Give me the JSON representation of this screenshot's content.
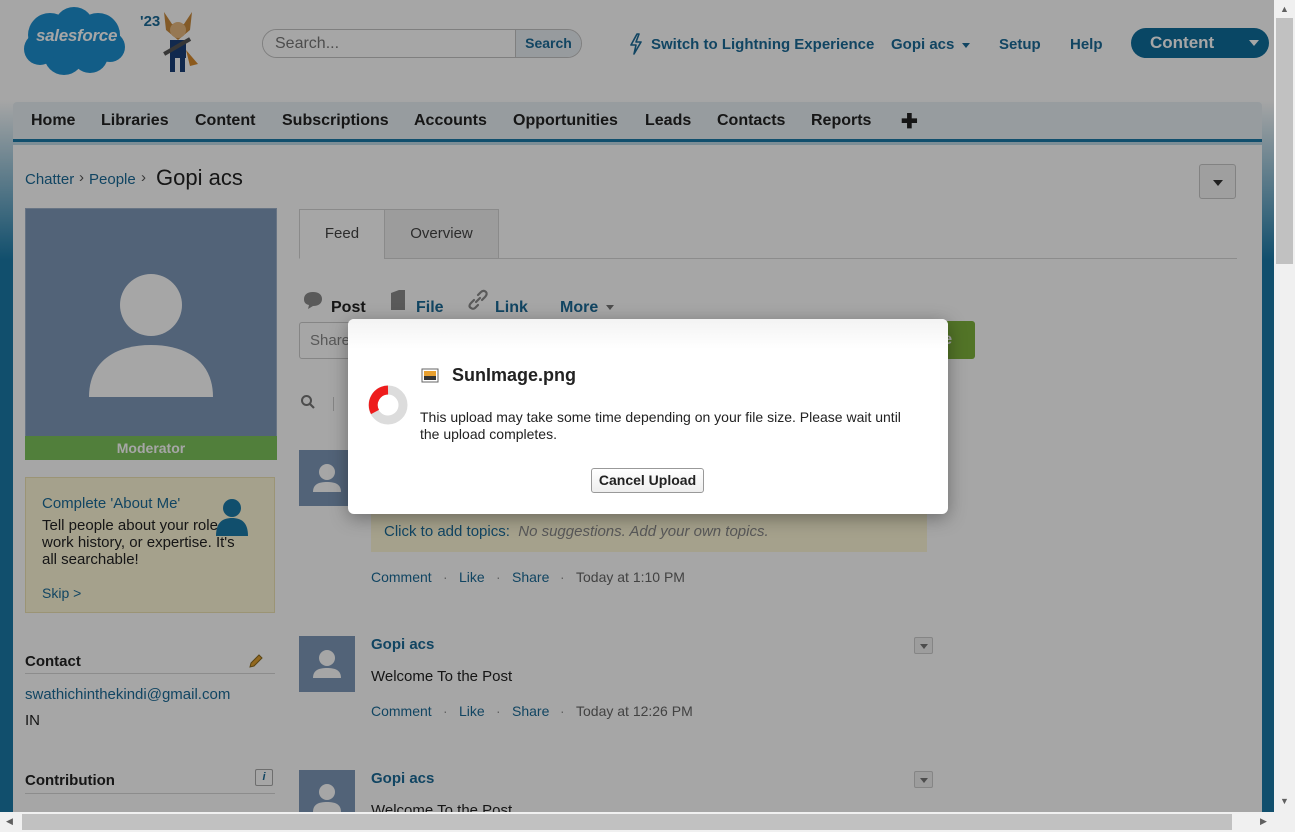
{
  "header": {
    "logo_text": "salesforce",
    "release_badge": "'23",
    "search_placeholder": "Search...",
    "search_button": "Search",
    "lightning_link": "Switch to Lightning Experience",
    "user_menu": "Gopi acs",
    "setup": "Setup",
    "help": "Help",
    "app_switcher": "Content"
  },
  "tabs": [
    "Home",
    "Libraries",
    "Content",
    "Subscriptions",
    "Accounts",
    "Opportunities",
    "Leads",
    "Contacts",
    "Reports"
  ],
  "add_tab_symbol": "✚",
  "breadcrumb": {
    "items": [
      "Chatter",
      "People"
    ],
    "sep": "›",
    "current": "Gopi acs"
  },
  "profile": {
    "role_badge": "Moderator",
    "about_title": "Complete 'About Me'",
    "about_body": "Tell people about your role, work history, or expertise. It's all searchable!",
    "skip": "Skip >",
    "contact_title": "Contact",
    "email": "swathichinthekindi@gmail.com",
    "country": "IN",
    "contribution_title": "Contribution",
    "info_icon": "i"
  },
  "feed_tabs": [
    "Feed",
    "Overview"
  ],
  "composer": {
    "post": "Post",
    "file": "File",
    "link": "Link",
    "more": "More",
    "share_placeholder": "Share",
    "share_button_partial": "re"
  },
  "posts": [
    {
      "topics_label": "Click to add topics:",
      "topics_hint": "No suggestions. Add your own topics.",
      "actions": [
        "Comment",
        "Like",
        "Share"
      ],
      "time": "Today at 1:10 PM"
    },
    {
      "author": "Gopi acs",
      "text": "Welcome To the Post",
      "actions": [
        "Comment",
        "Like",
        "Share"
      ],
      "time": "Today at 12:26 PM"
    },
    {
      "author": "Gopi acs",
      "text": "Welcome To the Post"
    }
  ],
  "dot_sep": "·",
  "modal": {
    "filename": "SunImage.png",
    "message": "This upload may take some time depending on your file size. Please wait until the upload completes.",
    "cancel_button": "Cancel Upload"
  },
  "colors": {
    "brand": "#1b7aa8",
    "link": "#1b6a97",
    "moderator": "#7dc35b",
    "share": "#7eb23c"
  }
}
